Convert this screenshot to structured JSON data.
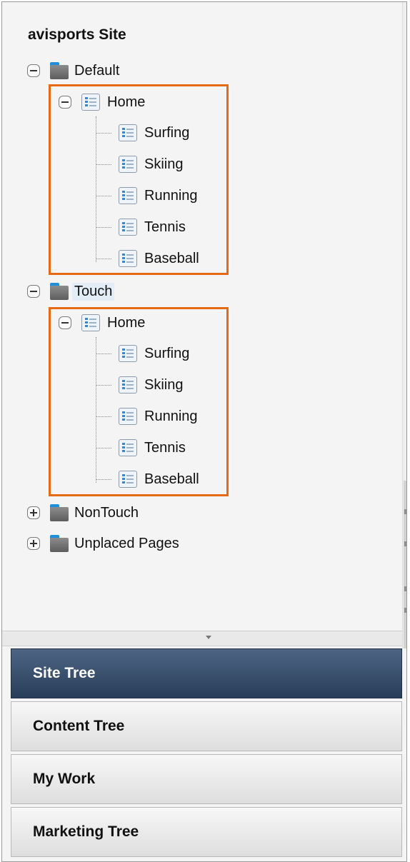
{
  "site_title": "avisports Site",
  "tree": {
    "default": {
      "label": "Default",
      "home": "Home",
      "children": [
        "Surfing",
        "Skiing",
        "Running",
        "Tennis",
        "Baseball"
      ]
    },
    "touch": {
      "label": "Touch",
      "home": "Home",
      "children": [
        "Surfing",
        "Skiing",
        "Running",
        "Tennis",
        "Baseball"
      ]
    },
    "nontouch": {
      "label": "NonTouch"
    },
    "unplaced": {
      "label": "Unplaced Pages"
    }
  },
  "accordion": {
    "items": [
      "Site Tree",
      "Content Tree",
      "My Work",
      "Marketing Tree"
    ],
    "active": "Site Tree"
  },
  "colors": {
    "highlight_border": "#e66a14",
    "active_panel": "#34496a",
    "folder_tab": "#1e8fd8",
    "page_icon_accent": "#3a86d0"
  },
  "icons": {
    "collapse": "minus-box-icon",
    "expand": "plus-box-icon",
    "folder": "folder-icon",
    "page": "page-icon"
  }
}
